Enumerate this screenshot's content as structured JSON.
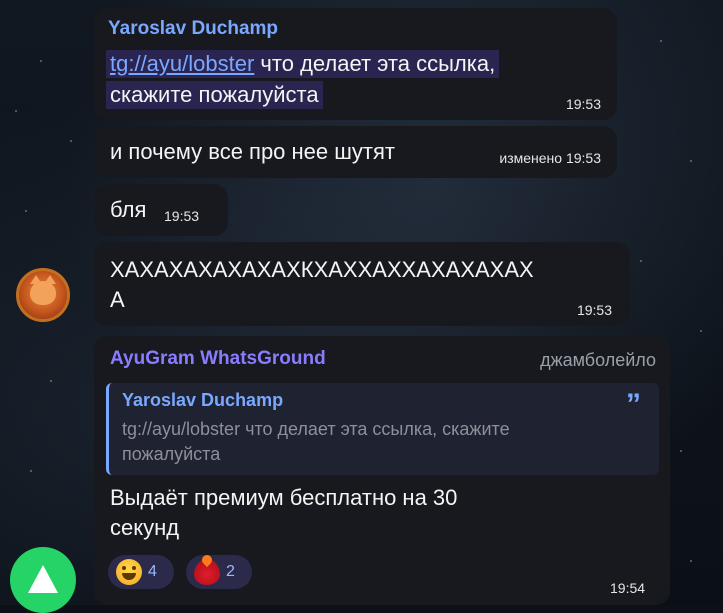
{
  "messages": {
    "m1": {
      "sender": "Yaroslav Duchamp",
      "link": "tg://ayu/lobster",
      "text_after_link": " что делает эта ссылка,",
      "line2": "скажите пожалуйста",
      "time": "19:53"
    },
    "m2": {
      "text": "и почему все про нее шутят",
      "edited_time": "изменено 19:53"
    },
    "m3": {
      "text": "бля",
      "time": "19:53"
    },
    "m4": {
      "line1": "ХАХАХАХАХАХАХКХАХХАХХАХАХАХАХ",
      "line2": "А",
      "time": "19:53"
    },
    "m5": {
      "sender": "AyuGram WhatsGround",
      "author_sign": "джамболейло",
      "reply_sender": "Yaroslav Duchamp",
      "reply_text_line1": "tg://ayu/lobster что делает эта ссылка, скажите",
      "reply_text_line2": "пожалуйста",
      "text_line1": "Выдаёт премиум бесплатно на 30",
      "text_line2": "секунд",
      "reactions": [
        {
          "icon": "grinning-face-icon",
          "count": "4"
        },
        {
          "icon": "fire-heart-icon",
          "count": "2"
        }
      ],
      "time": "19:54"
    }
  },
  "colors": {
    "sender_blue": "#7aa8ff",
    "sender_purple": "#8a7cff",
    "bubble_bg": "#17191e",
    "reaction_bg": "#2c2a4a",
    "whatsapp_green": "#25d366"
  }
}
